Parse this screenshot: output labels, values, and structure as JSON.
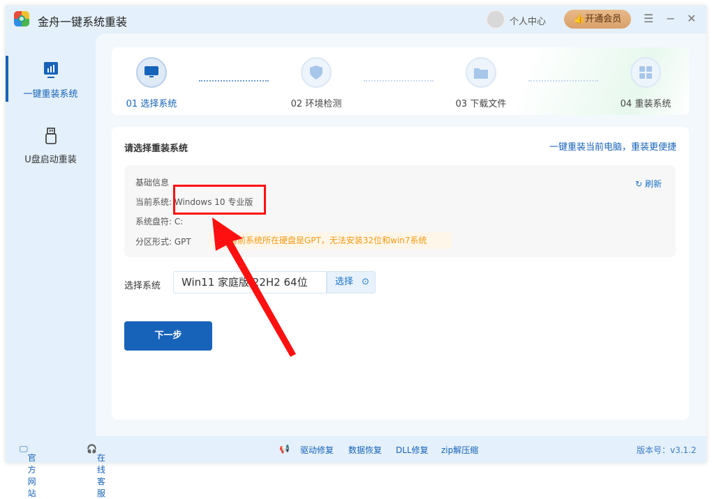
{
  "app": {
    "title": "金舟一键系统重装",
    "user_center": "个人中心",
    "vip": "开通会员"
  },
  "window_controls": {
    "menu": "☰",
    "minimize": "−",
    "close": "✕"
  },
  "sidebar": {
    "items": [
      {
        "label": "一键重装系统",
        "active": true
      },
      {
        "label": "U盘启动重装",
        "active": false
      }
    ]
  },
  "steps": [
    {
      "label": "01 选择系统",
      "active": true
    },
    {
      "label": "02 环境检测"
    },
    {
      "label": "03 下载文件"
    },
    {
      "label": "04 重装系统"
    }
  ],
  "card": {
    "title": "请选择重装系统",
    "link": "一键重装当前电脑，重装更便捷",
    "info": {
      "heading": "基础信息",
      "refresh": "刷新",
      "current_system_label": "当前系统:",
      "current_system": "Windows 10 专业版",
      "drive_label": "系统盘符:",
      "drive": "C:",
      "partition_label": "分区形式:",
      "partition": "GPT",
      "warning": "当前系统所在硬盘是GPT，无法安装32位和win7系统"
    },
    "select_label": "选择系统",
    "select_value": "Win11 家庭版 22H2 64位",
    "select_button": "选择",
    "next_button": "下一步"
  },
  "footer": {
    "website": "官方网站",
    "service": "在线客服",
    "driver": "驱动修复",
    "data": "数据恢复",
    "dll": "DLL修复",
    "zip": "zip解压缩",
    "version": "版本号：v3.1.2"
  },
  "colors": {
    "accent": "#1763b9",
    "warning": "#f19a12",
    "annotation": "#ff1010"
  }
}
